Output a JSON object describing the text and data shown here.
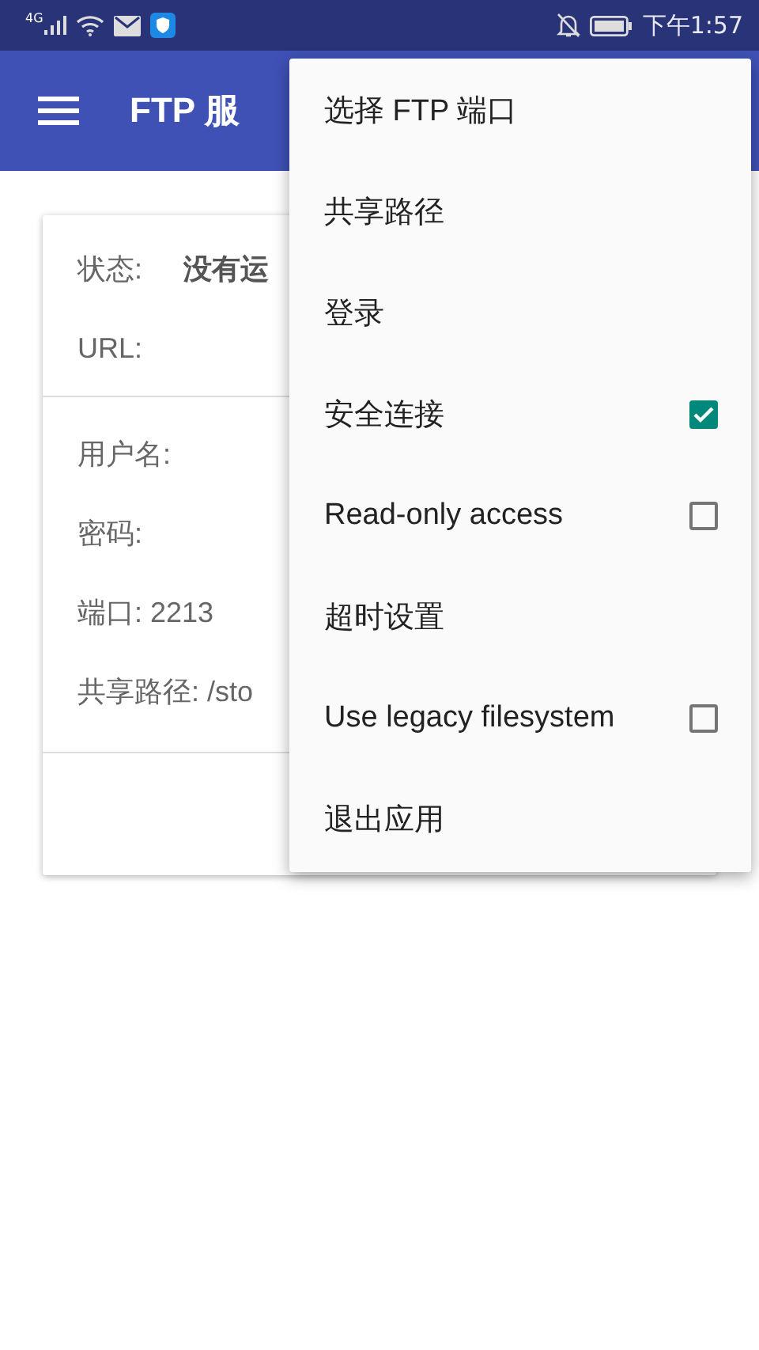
{
  "status_bar": {
    "network": "4G",
    "time": "下午1:57"
  },
  "app_bar": {
    "title": "FTP 服"
  },
  "card": {
    "status_label": "状态:",
    "status_value": "没有运",
    "url_label": "URL:",
    "fields": [
      "用户名:",
      "密码:",
      "端口: 2213",
      "共享路径: /sto"
    ]
  },
  "menu": [
    {
      "label": "选择 FTP 端口",
      "kind": "plain"
    },
    {
      "label": "共享路径",
      "kind": "plain"
    },
    {
      "label": "登录",
      "kind": "plain"
    },
    {
      "label": "安全连接",
      "kind": "checkbox",
      "checked": true
    },
    {
      "label": "Read-only access",
      "kind": "checkbox",
      "checked": false
    },
    {
      "label": "超时设置",
      "kind": "plain"
    },
    {
      "label": "Use legacy filesystem",
      "kind": "checkbox",
      "checked": false
    },
    {
      "label": "退出应用",
      "kind": "plain"
    }
  ]
}
